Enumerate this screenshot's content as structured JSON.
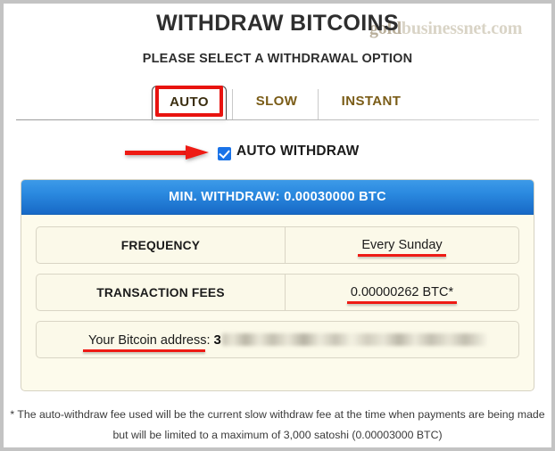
{
  "watermark": {
    "prefix": "gold",
    "suffix": "businessnet.com"
  },
  "header": {
    "title": "WITHDRAW BITCOINS",
    "subtitle": "PLEASE SELECT A WITHDRAWAL OPTION"
  },
  "tabs": [
    {
      "label": "AUTO",
      "active": true
    },
    {
      "label": "SLOW",
      "active": false
    },
    {
      "label": "INSTANT",
      "active": false
    }
  ],
  "auto_withdraw": {
    "label": "AUTO WITHDRAW",
    "checked": true
  },
  "panel": {
    "header": "MIN. WITHDRAW: 0.00030000 BTC",
    "rows": [
      {
        "label": "FREQUENCY",
        "value": "Every Sunday"
      },
      {
        "label": "TRANSACTION FEES",
        "value": "0.00000262 BTC*"
      }
    ],
    "address_row": {
      "label": "Your Bitcoin address:",
      "prefix": "3",
      "redacted": true
    }
  },
  "footnote": {
    "line1": "* The auto-withdraw fee used will be the current slow withdraw fee at the time when payments are being made",
    "line2": "but will be limited to a maximum of 3,000 satoshi (0.00003000 BTC)"
  },
  "colors": {
    "accent_blue": "#2b8ae0",
    "annotation_red": "#ee1b14",
    "tab_text": "#7a5c17",
    "panel_bg": "#fdfbec"
  }
}
